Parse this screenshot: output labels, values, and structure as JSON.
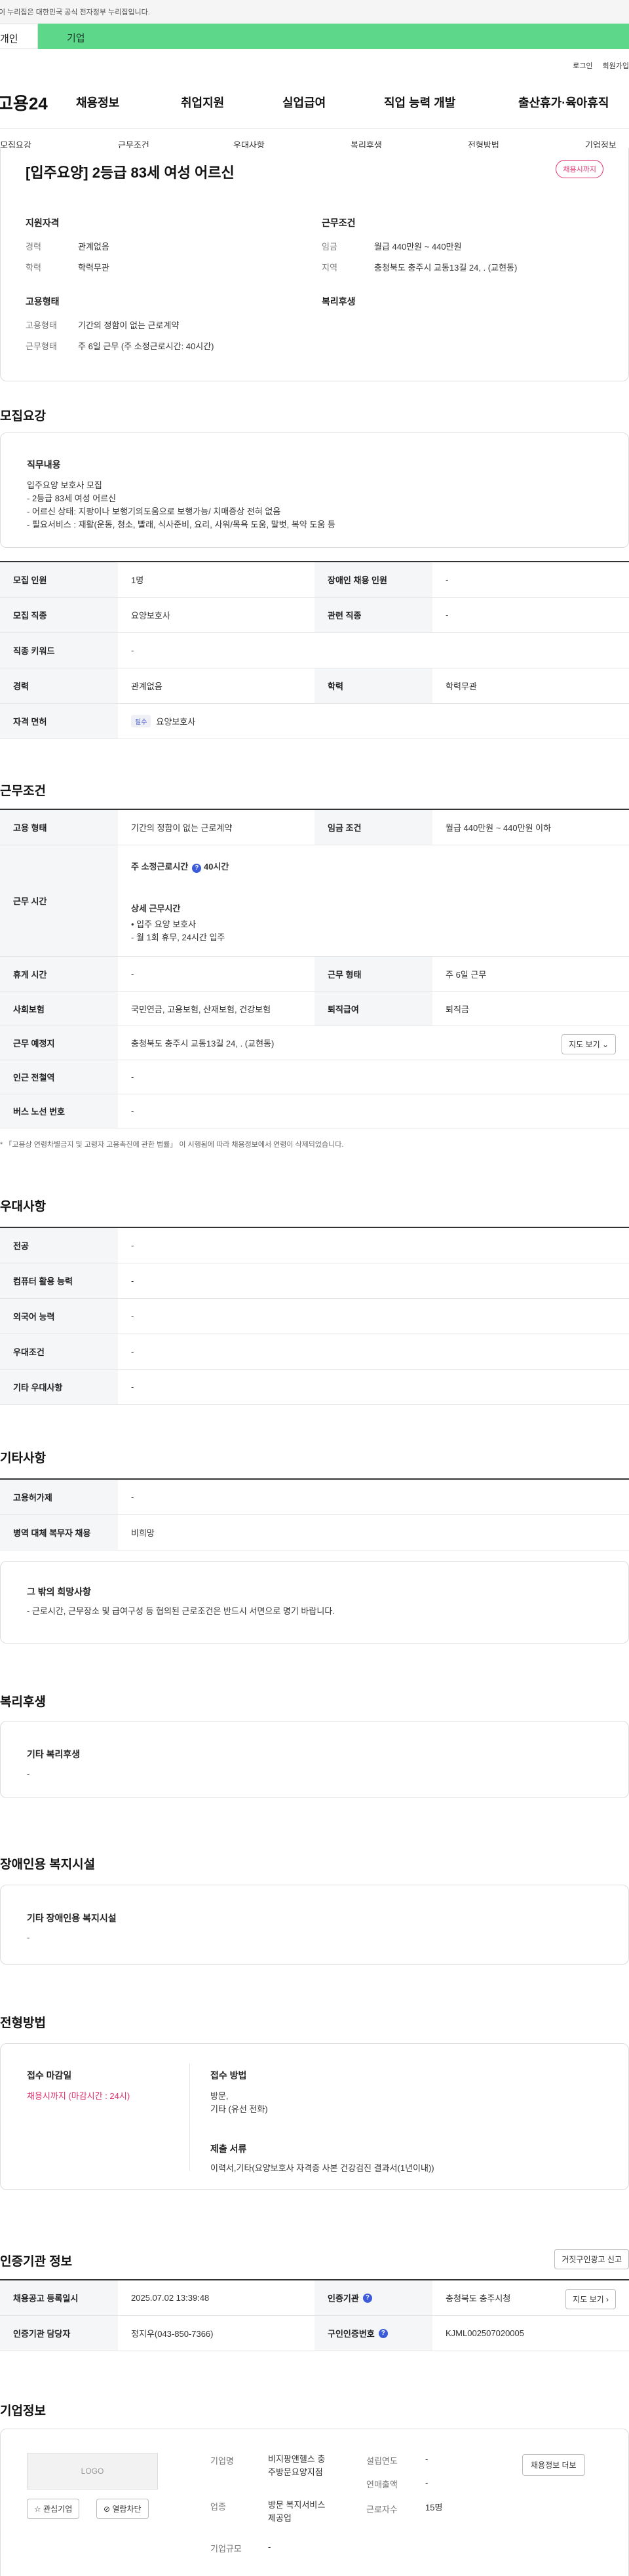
{
  "gov_banner": "이 누리집은 대한민국 공식 전자정부 누리집입니다.",
  "top_tabs": {
    "personal": "개인",
    "company": "기업"
  },
  "util": {
    "login": "로그인",
    "signup": "회원가입"
  },
  "logo": "고용24",
  "gnb": [
    "채용정보",
    "취업지원",
    "실업급여",
    "직업 능력 개발",
    "출산휴가·육아휴직"
  ],
  "subnav": [
    "모집요강",
    "근무조건",
    "우대사항",
    "복리후생",
    "전형방법",
    "기업정보"
  ],
  "job": {
    "title": "[입주요양] 2등급 83세 여성 어르신",
    "status": "채용시까지",
    "apply_qual_heading": "지원자격",
    "career_label": "경력",
    "career_value": "관계없음",
    "edu_label": "학력",
    "edu_value": "학력무관",
    "work_cond_heading": "근무조건",
    "wage_label": "임금",
    "wage_value": "월급 440만원 ~ 440만원",
    "area_label": "지역",
    "area_value": "충청북도 충주시 교동13길 24, . (교현동)",
    "emp_heading": "고용형태",
    "emp_type_label": "고용형태",
    "emp_type_value": "기간의 정함이 없는 근로계약",
    "work_form_label": "근무형태",
    "work_form_value": "주 6일 근무 (주 소정근로시간: 40시간)",
    "welfare_heading": "복리후생"
  },
  "recruit": {
    "section_title": "모집요강",
    "duty_heading": "직무내용",
    "duty_text": "입주요양 보호사 모집\n- 2등급 83세 여성 어르신\n- 어르신 상태: 지팡이나 보행기의도움으로 보행가능/ 치매증상 전혀 없음\n- 필요서비스 : 재활(운동, 청소, 빨래, 식사준비, 요리, 사워/목욕 도움, 말벗, 복약 도움 등",
    "rows": [
      {
        "k1": "모집 인원",
        "v1": "1명",
        "k2": "장애인 채용 인원",
        "v2": "-"
      },
      {
        "k1": "모집 직종",
        "v1": "요양보호사",
        "k2": "관련 직종",
        "v2": "-"
      },
      {
        "k1": "직종 키워드",
        "v1": "-"
      },
      {
        "k1": "경력",
        "v1": "관계없음",
        "k2": "학력",
        "v2": "학력무관"
      },
      {
        "k1": "자격 면허",
        "v1_pill": "필수",
        "v1": "요양보호사"
      }
    ]
  },
  "conditions": {
    "section_title": "근무조건",
    "emp_type_k": "고용 형태",
    "emp_type_v": "기간의 정함이 없는 근로계약",
    "wage_k": "임금 조건",
    "wage_v": "월급 440만원 ~ 440만원 이하",
    "hours_k": "근무 시간",
    "hours_weekly_label": "주 소정근로시간",
    "hours_weekly_value": "40시간",
    "hours_detail_heading": "상세 근무시간",
    "hours_detail": "• 입주 요양 보호사\n- 월 1회 휴무, 24시간 입주",
    "rest_k": "휴게 시간",
    "rest_v": "-",
    "form_k": "근무 형태",
    "form_v": "주 6일 근무",
    "insurance_k": "사회보험",
    "insurance_v": "국민연금, 고용보험, 산재보험, 건강보험",
    "severance_k": "퇴직급여",
    "severance_v": "퇴직금",
    "place_k": "근무 예정지",
    "place_v": "충청북도 충주시 교동13길 24, . (교현동)",
    "map_button": "지도 보기 ⌄",
    "subway_k": "인근 전철역",
    "subway_v": "-",
    "bus_k": "버스 노선 번호",
    "bus_v": "-",
    "note": "* 「고용상 연령차별금지 및 고령자 고용촉진에 관한 법률」 이 시행됨에 따라 채용정보에서 연령이 삭제되었습니다."
  },
  "preferred": {
    "section_title": "우대사항",
    "rows": [
      {
        "k": "전공",
        "v": "-"
      },
      {
        "k": "컴퓨터 활용 능력",
        "v": "-"
      },
      {
        "k": "외국어 능력",
        "v": "-"
      },
      {
        "k": "우대조건",
        "v": "-"
      },
      {
        "k": "기타 우대사항",
        "v": "-"
      }
    ]
  },
  "etc": {
    "section_title": "기타사항",
    "rows": [
      {
        "k": "고용허가제",
        "v": "-"
      },
      {
        "k": "병역 대체 복무자 채용",
        "v": "비희망"
      }
    ],
    "wish_heading": "그 밖의 희망사항",
    "wish_text": "- 근로시간, 근무장소 및 급여구성 등 협의된 근로조건은 반드시 서면으로 명기 바랍니다."
  },
  "welfare": {
    "section_title": "복리후생",
    "heading": "기타 복리후생",
    "text": "-"
  },
  "disabled": {
    "section_title": "장애인용 복지시설",
    "heading": "기타 장애인용 복지시설",
    "text": "-"
  },
  "selection": {
    "section_title": "전형방법",
    "deadline_heading": "접수 마감일",
    "deadline_value": "채용시까지 (마감시간 : 24시)",
    "method_heading": "접수 방법",
    "method_value": "방문,\n기타 (유선 전화)",
    "docs_heading": "제출 서류",
    "docs_value": "이력서,기타(요양보호사 자격증 사본 건강검진 결과서(1년이내))"
  },
  "agency": {
    "section_title": "인증기관 정보",
    "report_button": "거짓구인광고 신고",
    "reg_date_k": "채용공고 등록일시",
    "reg_date_v": "2025.07.02 13:39:48",
    "agency_k": "인증기관",
    "agency_v": "충청북도 충주시청",
    "map_button": "지도 보기 ›",
    "manager_k": "인증기관 담당자",
    "manager_v": "정지우(043-850-7366)",
    "cert_no_k": "구인인증번호",
    "cert_no_v": "KJML002507020005"
  },
  "company": {
    "section_title": "기업정보",
    "logo_text": "LOGO",
    "interest_button": "☆ 관심기업",
    "block_button": "⊘ 열람차단",
    "name_k": "기업명",
    "name_v": "비지팡앤헬스 충\n주방문요양지점",
    "industry_k": "업종",
    "industry_v": "방문 복지서비스\n제공업",
    "size_k": "기업규모",
    "size_v": "-",
    "founded_k": "설립연도",
    "founded_v": "-",
    "sales_k": "연매출액",
    "sales_v": "-",
    "employees_k": "근로자수",
    "employees_v": "15명",
    "more_jobs_button": "채용정보 더보"
  }
}
